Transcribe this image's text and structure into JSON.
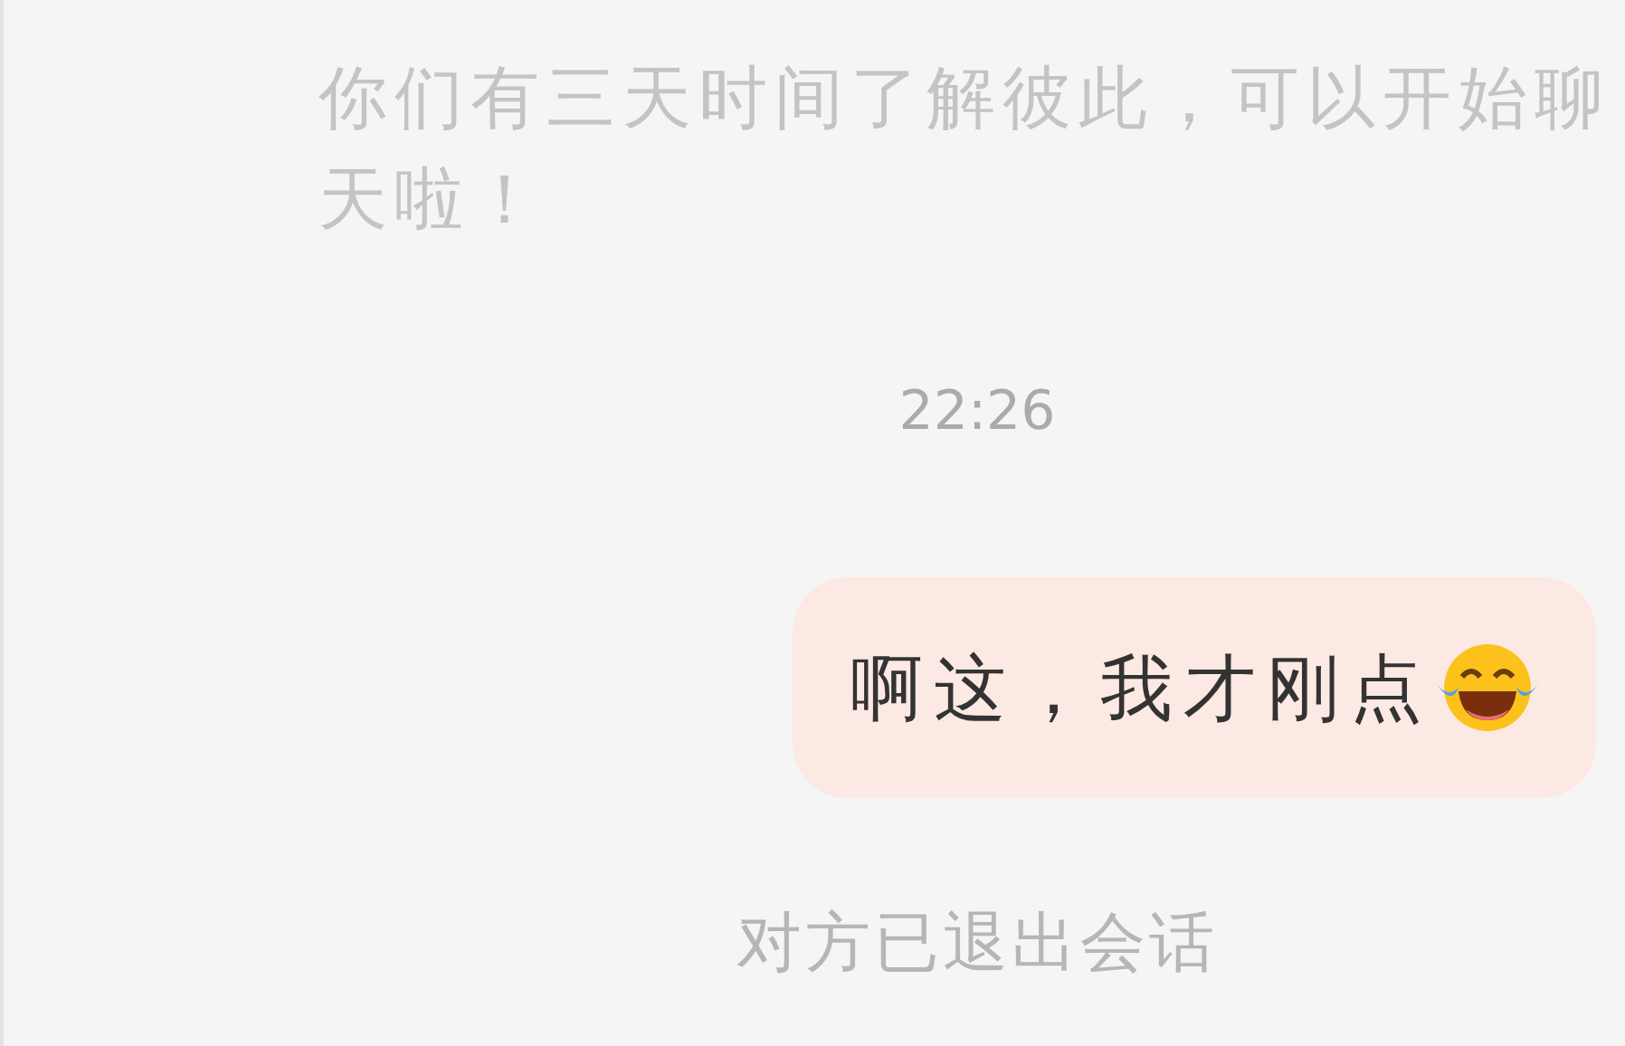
{
  "system_notice": "你们有三天时间了解彼此，可以开始聊天啦！",
  "timestamp": "22:26",
  "messages": [
    {
      "text": "啊这，我才刚点",
      "outgoing": true
    }
  ],
  "status_notice": "对方已退出会话"
}
